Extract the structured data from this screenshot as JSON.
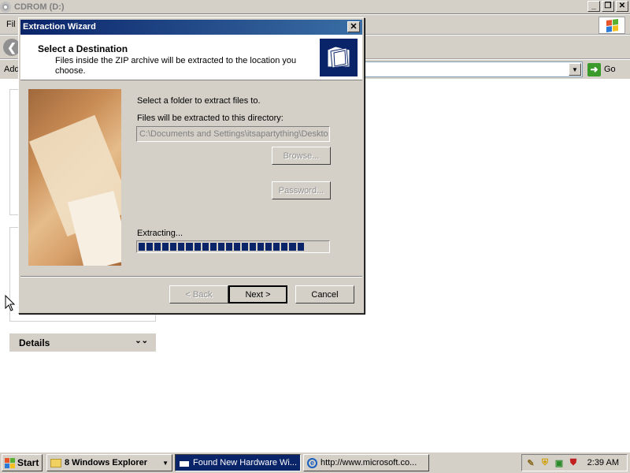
{
  "explorer": {
    "title": "CDROM (D:)",
    "menu_file": "Fil",
    "address_label": "Add",
    "go_label": "Go",
    "details_label": "Details"
  },
  "dialog": {
    "title": "Extraction Wizard",
    "header_title": "Select a Destination",
    "header_subtitle": "Files inside the ZIP archive will be extracted to the location you choose.",
    "instruction": "Select a folder to extract files to.",
    "dir_label": "Files will be extracted to this directory:",
    "dir_value": "C:\\Documents and Settings\\itsapartything\\Deskto",
    "browse_label": "Browse...",
    "password_label": "Password...",
    "extracting_label": "Extracting...",
    "progress_fraction": 0.86,
    "back_label": "< Back",
    "next_label": "Next >",
    "cancel_label": "Cancel"
  },
  "taskbar": {
    "start_label": "Start",
    "tasks": [
      {
        "label": "8 Windows Explorer"
      },
      {
        "label": "Found New Hardware Wi..."
      },
      {
        "label": "http://www.microsoft.co..."
      }
    ],
    "clock": "2:39 AM"
  },
  "colors": {
    "title_active": "#0a246a",
    "face": "#d4d0c8",
    "progress": "#0a246a"
  }
}
